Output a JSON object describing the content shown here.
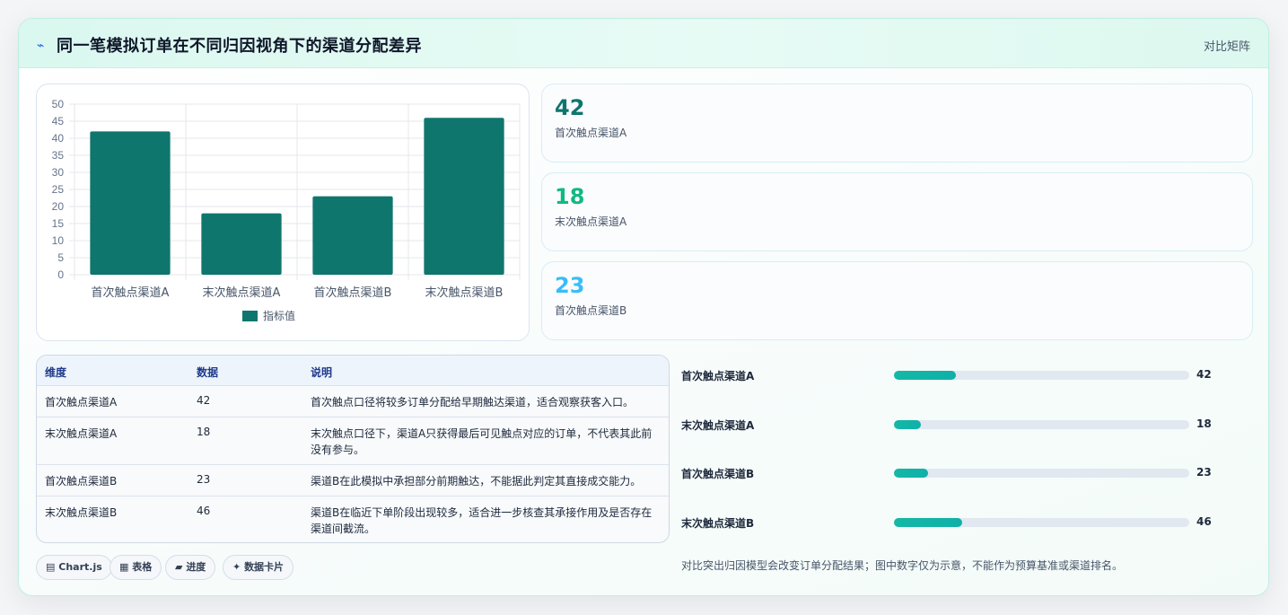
{
  "header": {
    "title": "同一笔模拟订单在不同归因视角下的渠道分配差异",
    "icon": "lightning-icon",
    "link_label": "对比矩阵"
  },
  "chart_data": {
    "type": "bar",
    "categories": [
      "首次触点渠道A",
      "末次触点渠道A",
      "首次触点渠道B",
      "末次触点渠道B"
    ],
    "series": [
      {
        "name": "指标值",
        "values": [
          42,
          18,
          23,
          46
        ]
      }
    ],
    "ylim": [
      0,
      50
    ],
    "yticks": [
      0,
      5,
      10,
      15,
      20,
      25,
      30,
      35,
      40,
      45,
      50
    ],
    "color": "#0f766e",
    "grid": true,
    "legend_position": "bottom"
  },
  "stats": [
    {
      "value": "42",
      "label": "首次触点渠道A",
      "color": "#0f766e"
    },
    {
      "value": "18",
      "label": "末次触点渠道A",
      "color": "#10b981"
    },
    {
      "value": "23",
      "label": "首次触点渠道B",
      "color": "#38bdf8"
    }
  ],
  "table": {
    "headers": [
      "维度",
      "数据",
      "说明"
    ],
    "rows": [
      [
        "首次触点渠道A",
        "42",
        "首次触点口径将较多订单分配给早期触达渠道，适合观察获客入口。"
      ],
      [
        "末次触点渠道A",
        "18",
        "末次触点口径下，渠道A只获得最后可见触点对应的订单，不代表其此前没有参与。"
      ],
      [
        "首次触点渠道B",
        "23",
        "渠道B在此模拟中承担部分前期触达，不能据此判定其直接成交能力。"
      ],
      [
        "末次触点渠道B",
        "46",
        "渠道B在临近下单阶段出现较多，适合进一步核查其承接作用及是否存在渠道间截流。"
      ]
    ]
  },
  "chips": [
    {
      "icon": "chart-icon",
      "glyph": "▤",
      "label": "Chart.js"
    },
    {
      "icon": "table-icon",
      "glyph": "▦",
      "label": "表格"
    },
    {
      "icon": "progress-icon",
      "glyph": "▰",
      "label": "进度"
    },
    {
      "icon": "sparkle-icon",
      "glyph": "✦",
      "label": "数据卡片"
    }
  ],
  "progress": {
    "max": 200,
    "items": [
      {
        "label": "首次触点渠道A",
        "value": 42,
        "display": "42"
      },
      {
        "label": "末次触点渠道A",
        "value": 18,
        "display": "18"
      },
      {
        "label": "首次触点渠道B",
        "value": 23,
        "display": "23"
      },
      {
        "label": "末次触点渠道B",
        "value": 46,
        "display": "46"
      }
    ]
  },
  "footnote": "对比突出归因模型会改变订单分配结果；图中数字仅为示意，不能作为预算基准或渠道排名。"
}
